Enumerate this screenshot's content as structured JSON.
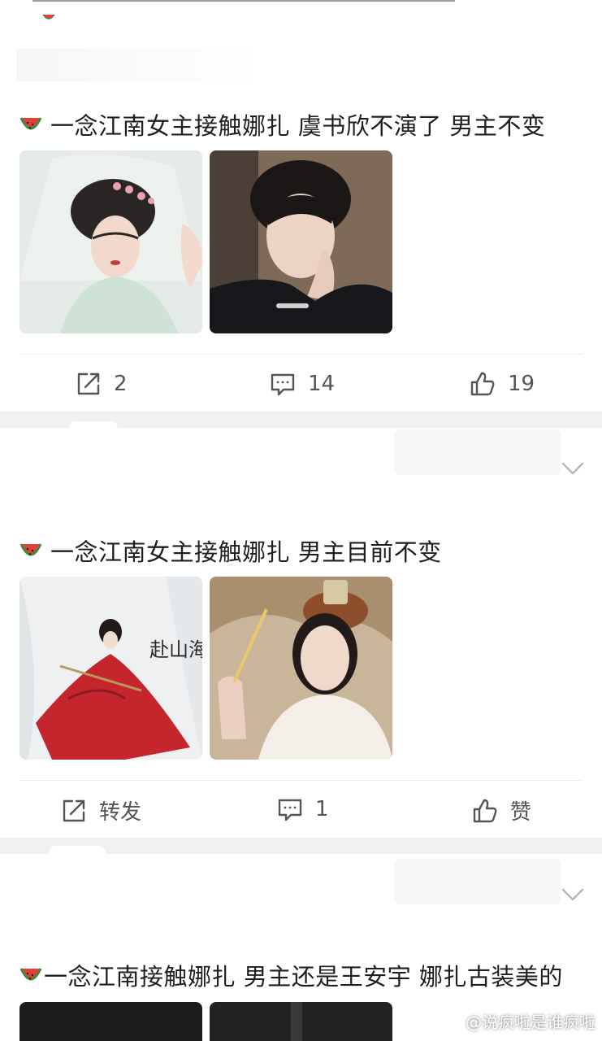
{
  "posts": [
    {
      "title": "一念江南女主接触娜扎 虞书欣不演了 男主不变",
      "images": [
        "bride-in-veil-photo",
        "man-in-black-suit-photo"
      ],
      "actions": {
        "repost": "2",
        "comment": "14",
        "like": "19"
      }
    },
    {
      "title": "一念江南女主接触娜扎 男主目前不变",
      "images": [
        "red-dress-poster-photo",
        "white-robe-actor-photo"
      ],
      "poster_text": {
        "calligraphy": "赴山海"
      },
      "actions": {
        "repost": "转发",
        "comment": "1",
        "like": "赞"
      }
    },
    {
      "title": "一念江南接触娜扎 男主还是王安宇 娜扎古装美的",
      "images": [
        "dark-photo-1",
        "dark-photo-2"
      ]
    }
  ],
  "watermark": "@说疯啦是谁疯啦",
  "colors": {
    "accent_red": "#e2413a",
    "melon_green": "#3e8b3a",
    "icon_gray": "#555555"
  }
}
